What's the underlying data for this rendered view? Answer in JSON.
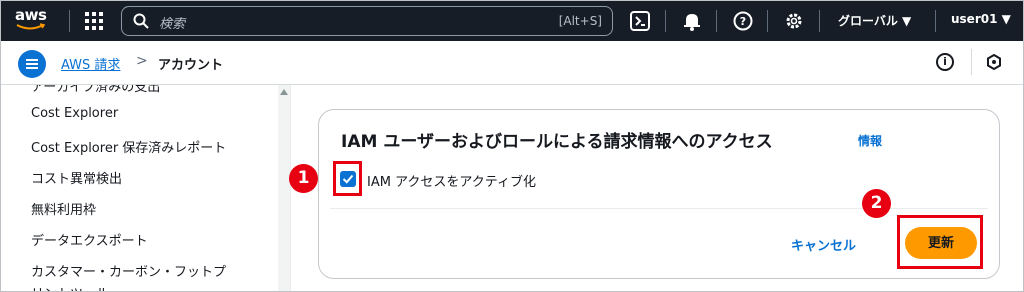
{
  "topbar": {
    "logo_text": "aws",
    "search_placeholder": "検索",
    "search_shortcut": "[Alt+S]",
    "region": "グローバル ▼",
    "user": "user01 ▼",
    "icons": [
      "services-grid-icon",
      "search-icon",
      "cloudshell-icon",
      "bell-icon",
      "help-icon",
      "gear-icon"
    ]
  },
  "breadcrumb": {
    "link": "AWS 請求",
    "separator": ">",
    "current": "アカウント"
  },
  "sidebar": {
    "cut_item": "アーカイブ済みの支出",
    "items": [
      "Cost Explorer",
      "Cost Explorer 保存済みレポート",
      "コスト異常検出",
      "無料利用枠",
      "データエクスポート",
      "カスタマー・カーボン・フットプ",
      "リントツール"
    ]
  },
  "card": {
    "title": "IAM ユーザーおよびロールによる請求情報へのアクセス",
    "info_link": "情報",
    "checkbox_label": "IAM アクセスをアクティブ化",
    "checkbox_checked": true,
    "cancel_label": "キャンセル",
    "update_label": "更新"
  },
  "annotations": {
    "badge_1": "1",
    "badge_2": "2",
    "color": "#e60012"
  },
  "colors": {
    "nav_bg": "#161d26",
    "link": "#0972d3",
    "primary_button": "#ff9900"
  }
}
